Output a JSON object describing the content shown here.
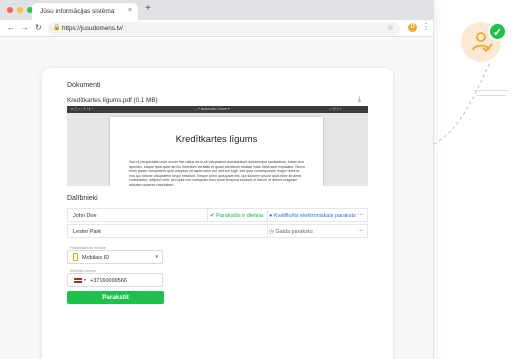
{
  "browser": {
    "tab_title": "Jūsu informācijas sistēma",
    "tab_close": "×",
    "new_tab": "+",
    "url": "https://jusudomens.lv/",
    "ext_badge": "D"
  },
  "colors": {
    "accent_green": "#1ec14b",
    "link_blue": "#2c6fd1",
    "tab_dots": [
      "#fe5f57",
      "#febc2e",
      "#28c840"
    ]
  },
  "documents": {
    "title": "Dokumenti",
    "file_name": "Kredītkartes līgums.pdf (0.1 MB)",
    "viewer": {
      "toolbar_left": "≡  ▢  ⌕  ‹  1 / 1  ›",
      "toolbar_mid": "–  +  Automatic Zoom ▾",
      "toolbar_right": "⤢  ⎙  ⤓  »",
      "pdf_title": "Kredītkartes līgums",
      "pdf_body": "Sed ut perspiciatis unde omnis iste natus error sit voluptatem accusantium doloremque laudantium, totam rem aperiam, eaque ipsa quae ab illo inventore veritatis et quasi architecto beatae vitae dicta sunt explicabo. Nemo enim ipsam voluptatem quia voluptas sit aspernatur aut odit aut fugit, sed quia consequuntur magni dolores eos qui ratione voluptatem sequi nesciunt. Neque porro quisquam est, qui dolorem ipsum quia dolor sit amet, consectetur, adipisci velit, sed quia non numquam eius modi tempora incidunt ut labore et dolore magnam aliquam quaerat voluptatem."
    }
  },
  "participants": {
    "title": "Dalībnieki",
    "rows": [
      {
        "name": "John Doe",
        "status": "Parakstīts ir dienņa",
        "type": "Kvalificēts elektroniskais paraksts"
      },
      {
        "name": "Lester Park",
        "status": "Gaida parakstu",
        "type": ""
      }
    ],
    "more": "⋯"
  },
  "signing": {
    "method_label": "Parakstīšanas metode",
    "method_value": "Mobilais ID",
    "phone_label": "Mobilais numurs",
    "phone_value": "+37160099566",
    "sign_button": "Parakstīt"
  }
}
